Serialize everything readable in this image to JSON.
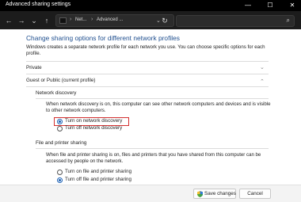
{
  "window": {
    "title": "Advanced sharing settings"
  },
  "titlebar_controls": {
    "minimize": "—",
    "maximize": "☐",
    "close": "✕"
  },
  "nav": {
    "back": "←",
    "forward": "→",
    "down": "⌄",
    "up": "↑",
    "breadcrumbs": [
      "Net...",
      "Advanced ..."
    ],
    "separator": "›",
    "dropdown": "⌄",
    "refresh": "↻",
    "search_placeholder": "",
    "search_icon": "⌕"
  },
  "main": {
    "heading": "Change sharing options for different network profiles",
    "intro": "Windows creates a separate network profile for each network you use. You can choose specific options for each profile.",
    "sections": {
      "private": "Private",
      "guest_public": "Guest or Public (current profile)",
      "network_discovery": "Network discovery",
      "file_printer_sharing": "File and printer sharing"
    },
    "chevrons": {
      "collapsed": "⌄",
      "expanded": "⌃"
    },
    "network_discovery": {
      "description": "When network discovery is on, this computer can see other network computers and devices and is visible to other network computers.",
      "options": [
        {
          "label": "Turn on network discovery",
          "selected": true
        },
        {
          "label": "Turn off network discovery",
          "selected": false
        }
      ]
    },
    "file_printer_sharing": {
      "description": "When file and printer sharing is on, files and printers that you have shared from this computer can be accessed by people on the network.",
      "options": [
        {
          "label": "Turn on file and printer sharing",
          "selected": false
        },
        {
          "label": "Turn off file and printer sharing",
          "selected": true
        }
      ]
    }
  },
  "footer": {
    "save_label": "Save changes",
    "cancel_label": "Cancel"
  },
  "colors": {
    "heading": "#1f4f8f",
    "accent": "#1a5fb4",
    "highlight": "#d32f2f"
  }
}
